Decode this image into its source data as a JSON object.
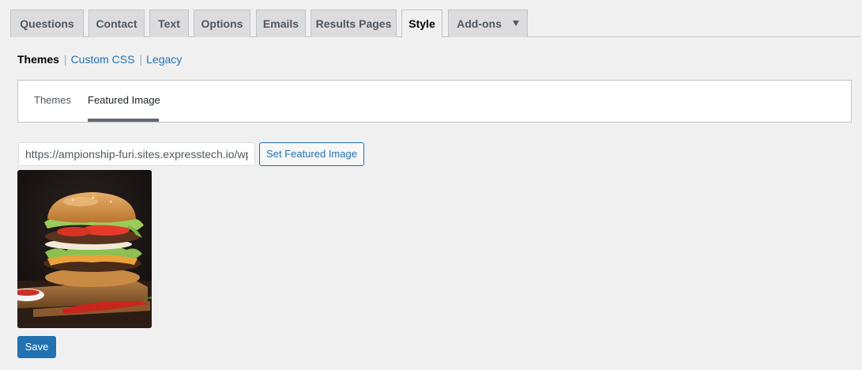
{
  "tabs": [
    {
      "label": "Questions"
    },
    {
      "label": "Contact"
    },
    {
      "label": "Text"
    },
    {
      "label": "Options"
    },
    {
      "label": "Emails"
    },
    {
      "label": "Results Pages"
    },
    {
      "label": "Style",
      "active": true
    },
    {
      "label": "Add-ons",
      "dropdown": true
    }
  ],
  "subnav": {
    "current": "Themes",
    "links": [
      "Custom CSS",
      "Legacy"
    ],
    "separator": "|"
  },
  "panel_tabs": [
    {
      "label": "Themes"
    },
    {
      "label": "Featured Image",
      "active": true
    }
  ],
  "featured_image": {
    "url_value": "https://ampionship-furi.sites.expresstech.io/wp",
    "set_button_label": "Set Featured Image",
    "preview_icon": "burger-photo"
  },
  "actions": {
    "save_label": "Save"
  },
  "colors": {
    "accent": "#2271b1",
    "background": "#f0f0f1",
    "tab_inactive": "#dcdcde",
    "panel_underline": "#646970"
  }
}
